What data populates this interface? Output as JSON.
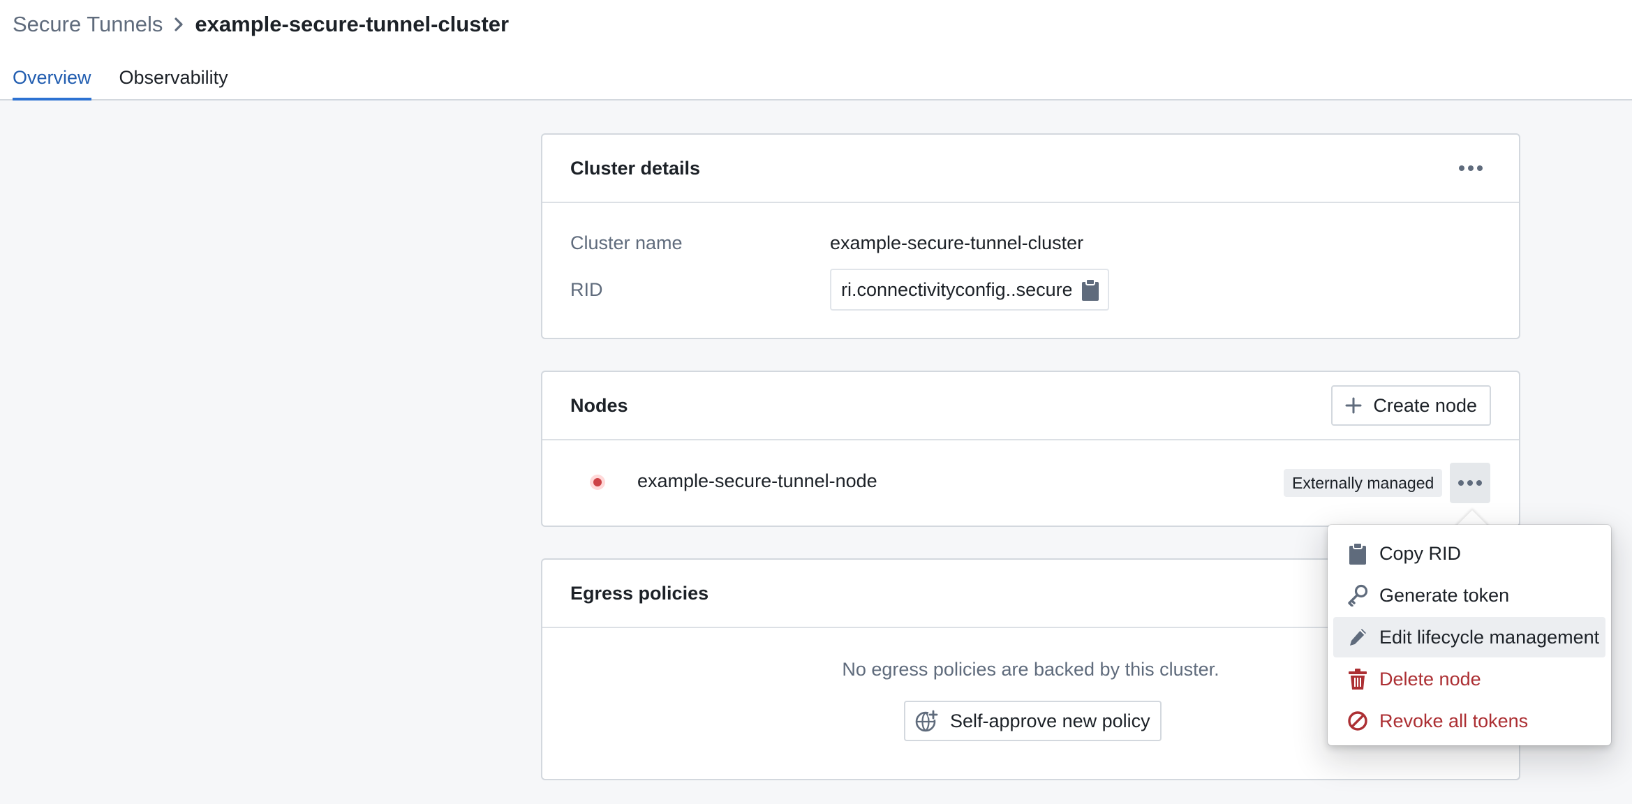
{
  "breadcrumb": {
    "parent": "Secure Tunnels",
    "current": "example-secure-tunnel-cluster"
  },
  "tabs": [
    {
      "label": "Overview",
      "active": true
    },
    {
      "label": "Observability",
      "active": false
    }
  ],
  "cluster_details": {
    "title": "Cluster details",
    "name_label": "Cluster name",
    "name_value": "example-secure-tunnel-cluster",
    "rid_label": "RID",
    "rid_value": "ri.connectivityconfig..secure-tunnel"
  },
  "nodes": {
    "title": "Nodes",
    "create_label": "Create node",
    "items": [
      {
        "name": "example-secure-tunnel-node",
        "status_color": "#cd4246",
        "badge": "Externally managed"
      }
    ]
  },
  "egress": {
    "title": "Egress policies",
    "empty_text": "No egress policies are backed by this cluster.",
    "approve_label": "Self-approve new policy"
  },
  "node_menu": {
    "items": [
      {
        "label": "Copy RID",
        "icon": "clipboard-icon"
      },
      {
        "label": "Generate token",
        "icon": "key-icon"
      },
      {
        "label": "Edit lifecycle management",
        "icon": "edit-icon"
      },
      {
        "label": "Delete node",
        "icon": "trash-icon"
      },
      {
        "label": "Revoke all tokens",
        "icon": "ban-icon"
      }
    ]
  },
  "colors": {
    "accent": "#2d72d2",
    "danger": "#ac2f33",
    "icon": "#5f6b7c"
  }
}
